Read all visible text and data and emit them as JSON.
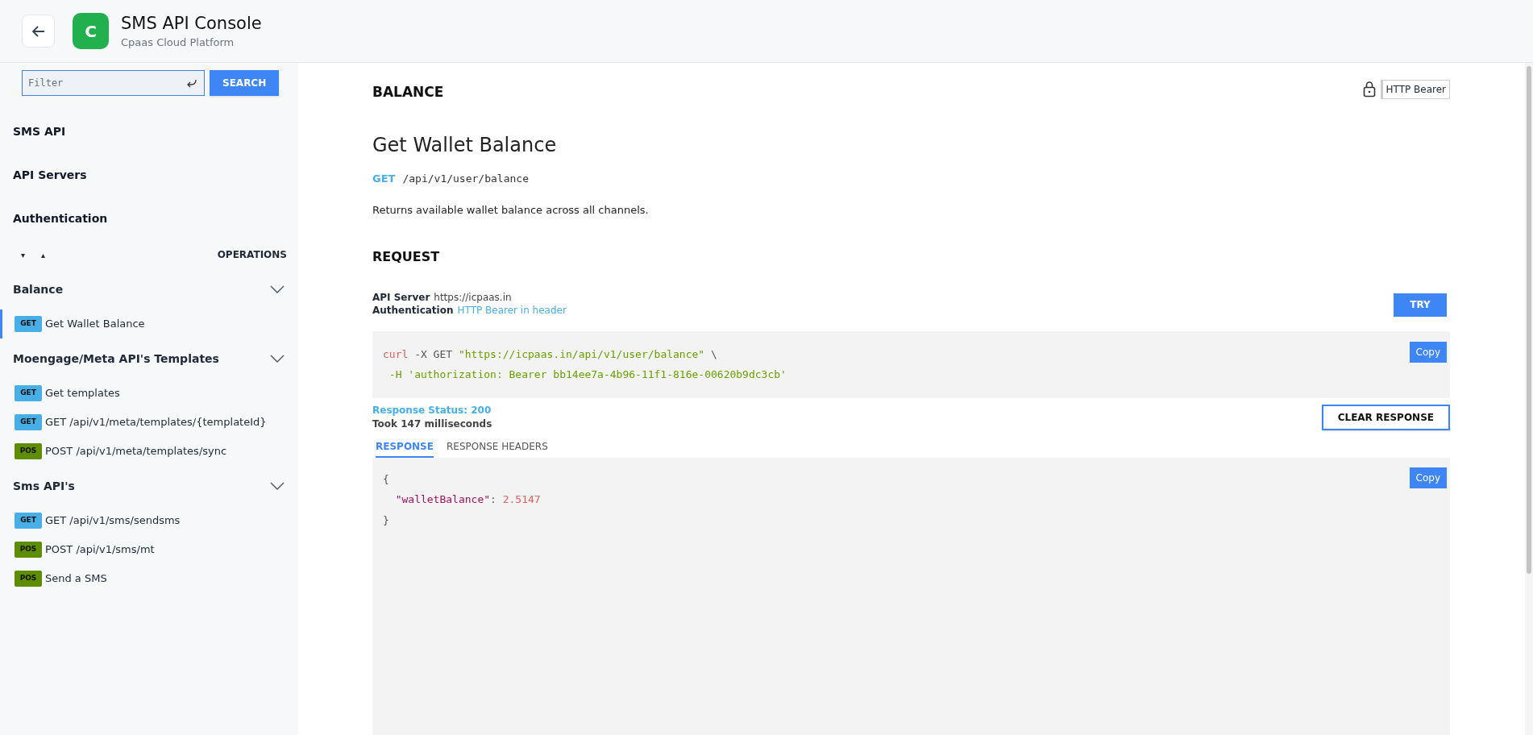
{
  "header": {
    "logo_letter": "C",
    "title": "SMS API Console",
    "subtitle": "Cpaas Cloud Platform"
  },
  "sidebar": {
    "filter": {
      "placeholder": "Filter"
    },
    "search_button": "SEARCH",
    "sections": [
      "SMS API",
      "API Servers",
      "Authentication"
    ],
    "operations_label": "OPERATIONS",
    "expand_glyph": "▾",
    "collapse_glyph": "▴",
    "groups": [
      {
        "title": "Balance",
        "expanded": true,
        "items": [
          {
            "method": "GET",
            "kind": "get",
            "label": "Get Wallet Balance",
            "selected": true
          }
        ]
      },
      {
        "title": "Moengage/Meta API's Templates",
        "expanded": true,
        "items": [
          {
            "method": "GET",
            "kind": "get",
            "label": "Get templates",
            "selected": false
          },
          {
            "method": "GET",
            "kind": "get",
            "label": "GET /api/v1/meta/templates/{templateId}",
            "selected": false
          },
          {
            "method": "POS",
            "kind": "post",
            "label": "POST /api/v1/meta/templates/sync",
            "selected": false
          }
        ]
      },
      {
        "title": "Sms API's",
        "expanded": true,
        "items": [
          {
            "method": "GET",
            "kind": "get",
            "label": "GET /api/v1/sms/sendsms",
            "selected": false
          },
          {
            "method": "POS",
            "kind": "post",
            "label": "POST /api/v1/sms/mt",
            "selected": false
          },
          {
            "method": "POS",
            "kind": "post",
            "label": "Send a SMS",
            "selected": false
          }
        ]
      }
    ]
  },
  "main": {
    "section_title": "BALANCE",
    "auth_badge": "HTTP Bearer",
    "operation_title": "Get Wallet Balance",
    "method": "GET",
    "path": "/api/v1/user/balance",
    "description": "Returns available wallet balance across all channels.",
    "request_title": "REQUEST",
    "server_label": "API Server",
    "server_value": "https://icpaas.in",
    "auth_label": "Authentication",
    "auth_value": "HTTP Bearer in header",
    "try_button": "TRY",
    "code_lines": [
      [
        {
          "kind": "command",
          "text": "curl"
        },
        {
          "kind": "plain",
          "text": " -X GET "
        },
        {
          "kind": "string",
          "text": "\"https://icpaas.in/api/v1/user/balance\""
        },
        {
          "kind": "plain",
          "text": " \\"
        }
      ],
      [
        {
          "kind": "string",
          "text": " -H 'authorization: Bearer bb14ee7a-4b96-11f1-816e-00620b9dc3cb'"
        }
      ]
    ],
    "copy_button": "Copy",
    "response_status": "Response Status: 200",
    "took": "Took 147 milliseconds",
    "clear_button": "CLEAR RESPONSE",
    "tabs": [
      {
        "label": "RESPONSE",
        "selected": true
      },
      {
        "label": "RESPONSE HEADERS",
        "selected": false
      }
    ],
    "response_lines": [
      [
        {
          "kind": "plain",
          "text": "{"
        }
      ],
      [
        {
          "kind": "key",
          "text": "  \"walletBalance\""
        },
        {
          "kind": "plain",
          "text": ": "
        },
        {
          "kind": "number",
          "text": "2.5147"
        }
      ],
      [
        {
          "kind": "plain",
          "text": "}"
        }
      ]
    ],
    "response_copy_button": "Copy"
  }
}
